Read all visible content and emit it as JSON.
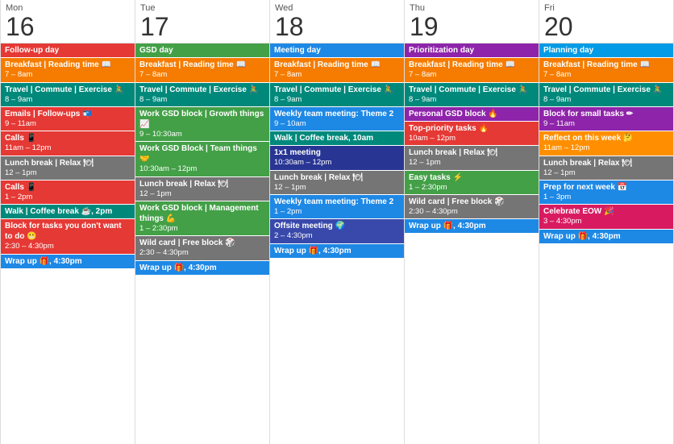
{
  "days": [
    {
      "name": "Mon",
      "number": "16",
      "label": "Follow-up day",
      "labelColor": "bg-red",
      "events": [
        {
          "title": "Breakfast | Reading time 📖",
          "time": "7 – 8am",
          "color": "bg-orange"
        },
        {
          "title": "Travel | Commute | Exercise 🚴",
          "time": "8 – 9am",
          "color": "bg-teal"
        },
        {
          "title": "Emails | Follow-ups 📬",
          "time": "9 – 11am",
          "color": "bg-red"
        },
        {
          "title": "Calls 📱",
          "time": "11am – 12pm",
          "color": "bg-red"
        },
        {
          "title": "Lunch break | Relax 🍽",
          "time": "12 – 1pm",
          "color": "bg-gray"
        },
        {
          "title": "Calls 📱",
          "time": "1 – 2pm",
          "color": "bg-red"
        },
        {
          "title": "Walk | Coffee break ☕, 2pm",
          "time": "",
          "color": "bg-teal"
        },
        {
          "title": "Block for tasks you don't want to do 😬",
          "time": "2:30 – 4:30pm",
          "color": "bg-red"
        },
        {
          "title": "Wrap up 🎁, 4:30pm",
          "time": "",
          "color": "bg-blue"
        }
      ]
    },
    {
      "name": "Tue",
      "number": "17",
      "label": "GSD day",
      "labelColor": "bg-green",
      "events": [
        {
          "title": "Breakfast | Reading time 📖",
          "time": "7 – 8am",
          "color": "bg-orange"
        },
        {
          "title": "Travel | Commute | Exercise 🚴",
          "time": "8 – 9am",
          "color": "bg-teal"
        },
        {
          "title": "Work GSD block | Growth things 📈",
          "time": "9 – 10:30am",
          "color": "bg-green"
        },
        {
          "title": "Work GSD Block | Team things 🤝",
          "time": "10:30am – 12pm",
          "color": "bg-green"
        },
        {
          "title": "Lunch break | Relax 🍽",
          "time": "12 – 1pm",
          "color": "bg-gray"
        },
        {
          "title": "Work GSD block | Management things 💪",
          "time": "1 – 2:30pm",
          "color": "bg-green"
        },
        {
          "title": "Wild card | Free block 🎲",
          "time": "2:30 – 4:30pm",
          "color": "bg-gray"
        },
        {
          "title": "Wrap up 🎁, 4:30pm",
          "time": "",
          "color": "bg-blue"
        }
      ]
    },
    {
      "name": "Wed",
      "number": "18",
      "label": "Meeting day",
      "labelColor": "bg-blue",
      "events": [
        {
          "title": "Breakfast | Reading time 📖",
          "time": "7 – 8am",
          "color": "bg-orange"
        },
        {
          "title": "Travel | Commute | Exercise 🚴",
          "time": "8 – 9am",
          "color": "bg-teal"
        },
        {
          "title": "Weekly team meeting: Theme 2",
          "time": "9 – 10am",
          "color": "bg-blue"
        },
        {
          "title": "Walk | Coffee break, 10am",
          "time": "",
          "color": "bg-teal"
        },
        {
          "title": "1x1 meeting",
          "time": "10:30am – 12pm",
          "color": "bg-dark-blue"
        },
        {
          "title": "Lunch break | Relax 🍽",
          "time": "12 – 1pm",
          "color": "bg-gray"
        },
        {
          "title": "Weekly team meeting: Theme 2",
          "time": "1 – 2pm",
          "color": "bg-blue"
        },
        {
          "title": "Offsite meeting 🌍",
          "time": "2 – 4:30pm",
          "color": "bg-indigo"
        },
        {
          "title": "Wrap up 🎁, 4:30pm",
          "time": "",
          "color": "bg-blue"
        }
      ]
    },
    {
      "name": "Thu",
      "number": "19",
      "label": "Prioritization day",
      "labelColor": "bg-purple",
      "events": [
        {
          "title": "Breakfast | Reading time 📖",
          "time": "7 – 8am",
          "color": "bg-orange"
        },
        {
          "title": "Travel | Commute | Exercise 🚴",
          "time": "8 – 9am",
          "color": "bg-teal"
        },
        {
          "title": "Personal GSD block 🔥",
          "time": "",
          "color": "bg-purple"
        },
        {
          "title": "Top-priority tasks 🔥",
          "time": "10am – 12pm",
          "color": "bg-red"
        },
        {
          "title": "Lunch break | Relax 🍽",
          "time": "12 – 1pm",
          "color": "bg-gray"
        },
        {
          "title": "Easy tasks ⚡",
          "time": "1 – 2:30pm",
          "color": "bg-green"
        },
        {
          "title": "Wild card | Free block 🎲",
          "time": "2:30 – 4:30pm",
          "color": "bg-gray"
        },
        {
          "title": "Wrap up 🎁, 4:30pm",
          "time": "",
          "color": "bg-blue"
        }
      ]
    },
    {
      "name": "Fri",
      "number": "20",
      "label": "Planning day",
      "labelColor": "bg-light-blue",
      "events": [
        {
          "title": "Breakfast | Reading time 📖",
          "time": "7 – 8am",
          "color": "bg-orange"
        },
        {
          "title": "Travel | Commute | Exercise 🚴",
          "time": "8 – 9am",
          "color": "bg-teal"
        },
        {
          "title": "Block for small tasks ✏",
          "time": "9 – 11am",
          "color": "bg-purple"
        },
        {
          "title": "Reflect on this week 🤔",
          "time": "11am – 12pm",
          "color": "bg-amber"
        },
        {
          "title": "Lunch break | Relax 🍽",
          "time": "12 – 1pm",
          "color": "bg-gray"
        },
        {
          "title": "Prep for next week 📅",
          "time": "1 – 3pm",
          "color": "bg-blue"
        },
        {
          "title": "Celebrate EOW 🎉",
          "time": "3 – 4:30pm",
          "color": "bg-pink"
        },
        {
          "title": "Wrap up 🎁, 4:30pm",
          "time": "",
          "color": "bg-blue"
        }
      ]
    }
  ]
}
